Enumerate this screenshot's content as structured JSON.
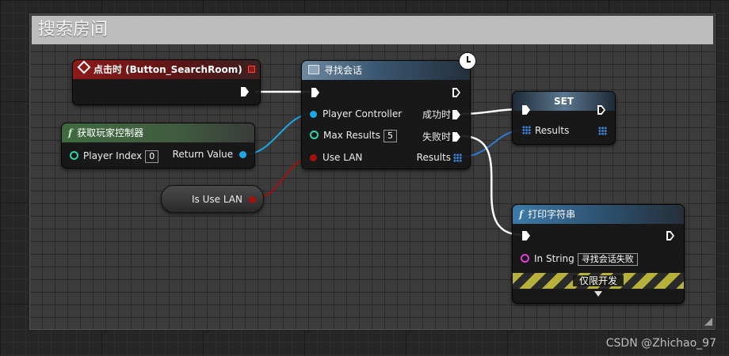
{
  "comment": {
    "title": "搜索房间"
  },
  "event_node": {
    "title": "点击时 (Button_SearchRoom)"
  },
  "get_controller_node": {
    "title": "获取玩家控制器",
    "player_index_label": "Player Index",
    "player_index_value": "0",
    "return_value_label": "Return Value"
  },
  "is_use_lan_node": {
    "label": "Is Use LAN"
  },
  "find_sessions_node": {
    "title": "寻找会话",
    "player_controller_label": "Player Controller",
    "max_results_label": "Max Results",
    "max_results_value": "5",
    "use_lan_label": "Use LAN",
    "on_success_label": "成功时",
    "on_failure_label": "失败时",
    "results_label": "Results"
  },
  "set_node": {
    "title": "SET",
    "results_label": "Results"
  },
  "print_node": {
    "title": "打印字符串",
    "in_string_label": "In String",
    "in_string_value": "寻找会话失败",
    "dev_only_label": "仅限开发"
  },
  "icons": {
    "event": "event-diamond-icon",
    "function": "function-f-icon",
    "async": "async-node-icon",
    "latent": "clock-icon",
    "expand": "expand-arrow-icon"
  },
  "colors": {
    "exec_wire": "#ffffff",
    "object_pin": "#1aa8e8",
    "int_pin": "#2ed2a8",
    "bool_pin": "#a31010",
    "array_pin": "#2f7bd6",
    "string_pin": "#e53bd6",
    "event_header": "#8d1a1a",
    "function_header": "#3f6b3f"
  },
  "watermark": "CSDN @Zhichao_97"
}
